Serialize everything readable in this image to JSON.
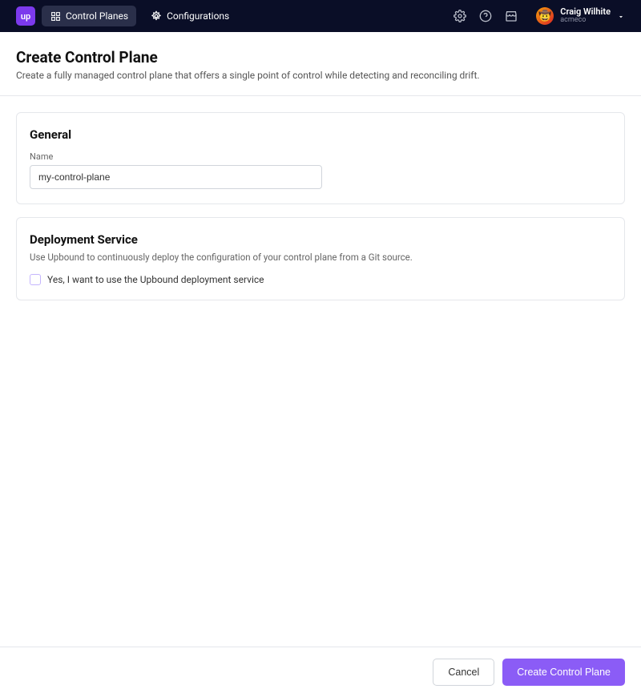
{
  "nav": {
    "logo": "up",
    "items": [
      {
        "label": "Control Planes"
      },
      {
        "label": "Configurations"
      }
    ]
  },
  "user": {
    "name": "Craig Wilhite",
    "org": "acmeco",
    "avatar_emoji": "🤠"
  },
  "header": {
    "title": "Create Control Plane",
    "subtitle": "Create a fully managed control plane that offers a single point of control while detecting and reconciling drift."
  },
  "general": {
    "section_title": "General",
    "name_label": "Name",
    "name_value": "my-control-plane"
  },
  "deployment": {
    "section_title": "Deployment Service",
    "description": "Use Upbound to continuously deploy the configuration of your control plane from a Git source.",
    "checkbox_label": "Yes, I want to use the Upbound deployment service"
  },
  "footer": {
    "cancel": "Cancel",
    "submit": "Create Control Plane"
  }
}
